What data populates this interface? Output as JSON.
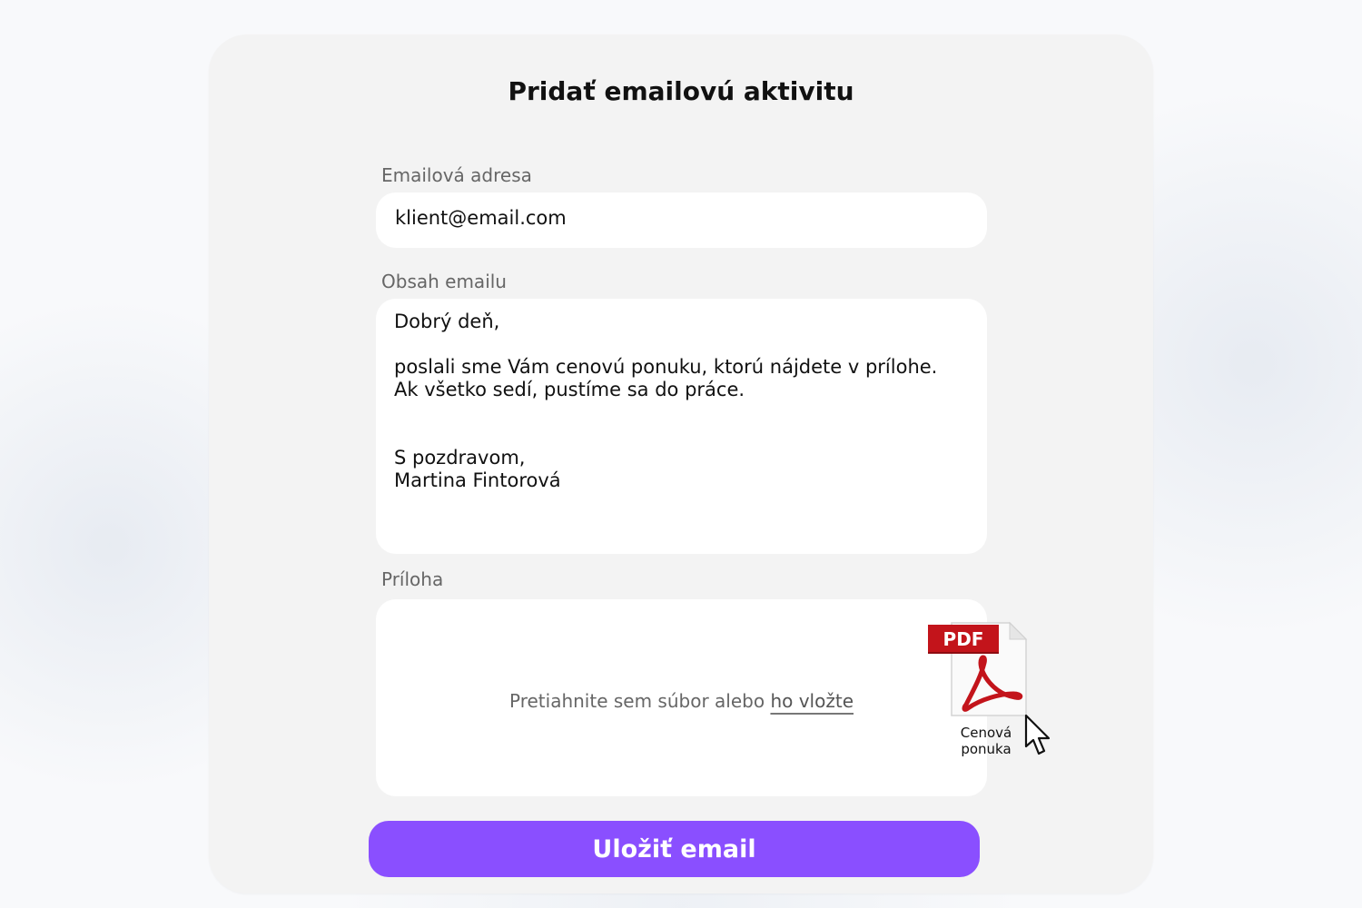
{
  "form": {
    "title": "Pridať emailovú aktivitu",
    "email_label": "Emailová adresa",
    "email_value": "klient@email.com",
    "body_label": "Obsah emailu",
    "body": {
      "greeting": "Dobrý deň,",
      "line1": "poslali sme Vám cenovú ponuku, ktorú nájdete v prílohe.",
      "line2": "Ak všetko sedí, pustíme sa do práce.",
      "closing": "S pozdravom,",
      "signature": "Martina Fintorová"
    },
    "attachment_label": "Príloha",
    "drop_text": "Pretiahnite sem súbor alebo",
    "drop_link": "ho vložte",
    "file": {
      "badge": "PDF",
      "name_line1": "Cenová",
      "name_line2": "ponuka",
      "icon": "pdf-file-icon"
    },
    "save_label": "Uložiť email"
  },
  "colors": {
    "accent": "#8a4fff",
    "card": "#f3f3f3",
    "pdf_red": "#c3141b"
  }
}
